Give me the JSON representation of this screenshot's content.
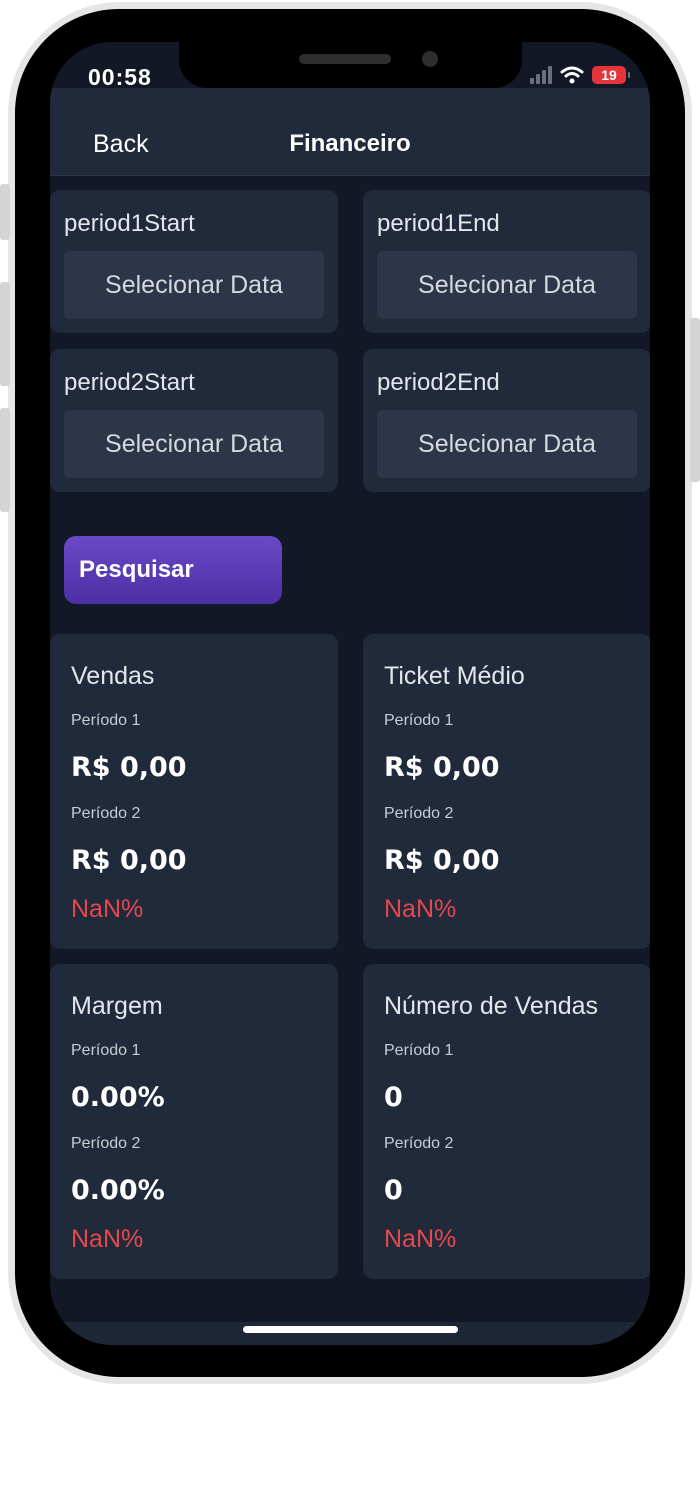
{
  "status_bar": {
    "time": "00:58",
    "battery": "19"
  },
  "nav": {
    "back_label": "Back",
    "title": "Financeiro"
  },
  "date_pickers": [
    {
      "label": "period1Start",
      "button": "Selecionar Data"
    },
    {
      "label": "period1End",
      "button": "Selecionar Data"
    },
    {
      "label": "period2Start",
      "button": "Selecionar Data"
    },
    {
      "label": "period2End",
      "button": "Selecionar Data"
    }
  ],
  "search_button": "Pesquisar",
  "metrics": [
    {
      "title": "Vendas",
      "period1_label": "Período 1",
      "period1_value": "R$ 0,00",
      "period2_label": "Período 2",
      "period2_value": "R$ 0,00",
      "change": "NaN%"
    },
    {
      "title": "Ticket Médio",
      "period1_label": "Período 1",
      "period1_value": "R$ 0,00",
      "period2_label": "Período 2",
      "period2_value": "R$ 0,00",
      "change": "NaN%"
    },
    {
      "title": "Margem",
      "period1_label": "Período 1",
      "period1_value": "0.00%",
      "period2_label": "Período 2",
      "period2_value": "0.00%",
      "change": "NaN%"
    },
    {
      "title": "Número de Vendas",
      "period1_label": "Período 1",
      "period1_value": "0",
      "period2_label": "Período 2",
      "period2_value": "0",
      "change": "NaN%"
    }
  ],
  "colors": {
    "background": "#121826",
    "card": "#212a3a",
    "accent": "#5b3cc0",
    "negative": "#e5484d"
  }
}
